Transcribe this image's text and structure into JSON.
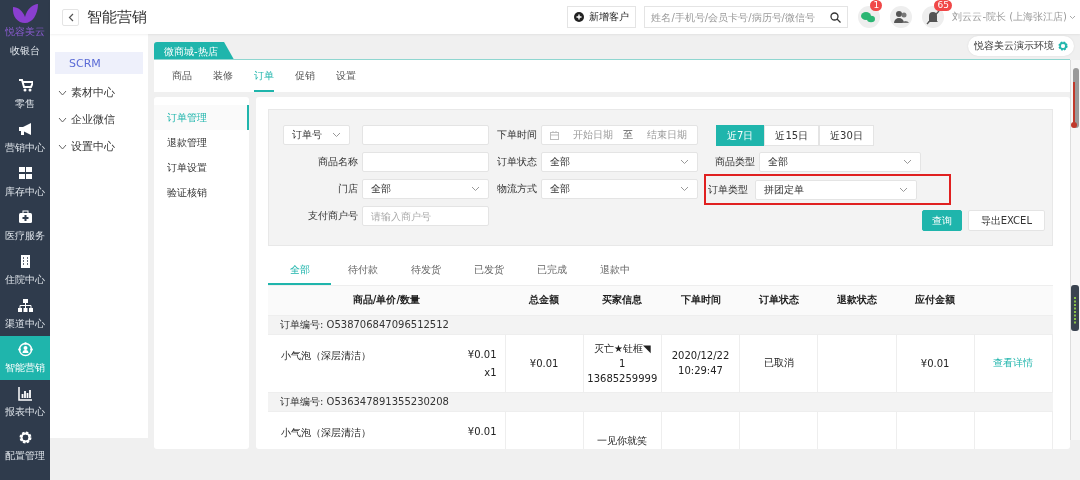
{
  "logo": {
    "text": "悦容美云"
  },
  "nav": [
    {
      "label": "收银台",
      "kind": "none",
      "selected": false
    },
    {
      "label": "零售",
      "kind": "cart",
      "selected": false
    },
    {
      "label": "营销中心",
      "kind": "megaphone",
      "selected": false
    },
    {
      "label": "库存中心",
      "kind": "grid",
      "selected": false
    },
    {
      "label": "医疗服务",
      "kind": "medkit",
      "selected": false
    },
    {
      "label": "住院中心",
      "kind": "building",
      "selected": false
    },
    {
      "label": "渠道中心",
      "kind": "hierarchy",
      "selected": false
    },
    {
      "label": "智能营销",
      "kind": "target",
      "selected": true
    },
    {
      "label": "报表中心",
      "kind": "chart",
      "selected": false
    },
    {
      "label": "配置管理",
      "kind": "gear",
      "selected": false
    }
  ],
  "header": {
    "title": "智能营销",
    "add_button": "新增客户",
    "search": {
      "placeholder": "姓名/手机号/会员卡号/病历号/微信号"
    },
    "icons": [
      {
        "kind": "chat",
        "badge": "1"
      },
      {
        "kind": "group"
      },
      {
        "kind": "bell",
        "badge": "65"
      }
    ],
    "user": "刘云云-院长 (上海张江店)"
  },
  "sub_nav": [
    {
      "label": "SCRM",
      "kind": "link",
      "selected": true
    },
    {
      "label": "素材中心",
      "kind": "group",
      "selected": false
    },
    {
      "label": "企业微信",
      "kind": "group",
      "selected": false
    },
    {
      "label": "设置中心",
      "kind": "group",
      "selected": false
    }
  ],
  "store_tab": "微商城-热店",
  "environment": "悦容美云演示环境",
  "tabs": [
    {
      "label": "商品",
      "selected": false
    },
    {
      "label": "装修",
      "selected": false
    },
    {
      "label": "订单",
      "selected": true
    },
    {
      "label": "促销",
      "selected": false
    },
    {
      "label": "设置",
      "selected": false
    }
  ],
  "side_menu": [
    {
      "label": "订单管理",
      "selected": true
    },
    {
      "label": "退款管理",
      "selected": false
    },
    {
      "label": "订单设置",
      "selected": false
    },
    {
      "label": "验证核销",
      "selected": false
    }
  ],
  "filters": [
    [
      {
        "kind": "select",
        "value": "订单号"
      },
      {
        "kind": "input"
      },
      {
        "kind": "label",
        "text": "下单时间"
      },
      {
        "kind": "daterange",
        "start": "开始日期",
        "separator": "至",
        "end": "结束日期"
      },
      {
        "kind": "segmented",
        "options": [
          {
            "label": "近7日",
            "selected": true
          },
          {
            "label": "近15日",
            "selected": false
          },
          {
            "label": "近30日",
            "selected": false
          }
        ]
      }
    ],
    [
      {
        "kind": "label",
        "text": "商品名称"
      },
      {
        "kind": "input"
      },
      {
        "kind": "label",
        "text": "订单状态"
      },
      {
        "kind": "select",
        "value": "全部"
      },
      {
        "kind": "label",
        "text": "商品类型"
      },
      {
        "kind": "select",
        "value": "全部"
      }
    ],
    [
      {
        "kind": "label",
        "text": "门店"
      },
      {
        "kind": "select",
        "value": "全部"
      },
      {
        "kind": "label",
        "text": "物流方式"
      },
      {
        "kind": "select",
        "value": "全部"
      },
      {
        "kind": "group",
        "highlighted": true,
        "label": "订单类型",
        "value": "拼团定单"
      }
    ],
    [
      {
        "kind": "label",
        "text": "支付商户号"
      },
      {
        "kind": "input",
        "placeholder": "请输入商户号"
      },
      {
        "kind": "actions",
        "buttons": [
          {
            "label": "查询",
            "primary": true
          },
          {
            "label": "导出EXCEL",
            "primary": false
          }
        ]
      }
    ]
  ],
  "status_tabs": [
    {
      "label": "全部",
      "selected": true
    },
    {
      "label": "待付款",
      "selected": false
    },
    {
      "label": "待发货",
      "selected": false
    },
    {
      "label": "已发货",
      "selected": false
    },
    {
      "label": "已完成",
      "selected": false
    },
    {
      "label": "退款中",
      "selected": false
    }
  ],
  "table": {
    "columns": [
      "商品/单价/数量",
      "总金额",
      "买家信息",
      "下单时间",
      "订单状态",
      "退款状态",
      "应付金额"
    ],
    "orders": [
      {
        "order_no": "订单编号: O538706847096512512",
        "product": "小气泡（深层清洁）",
        "price": "¥0.01",
        "qty": "x1",
        "total": "¥0.01",
        "buyer": [
          "灭亡★钍框◥",
          "1",
          "13685259999"
        ],
        "time": [
          "2020/12/22",
          "10:29:47"
        ],
        "status": "已取消",
        "payable": "¥0.01",
        "action": "查看详情"
      },
      {
        "order_no": "订单编号: O536347891355230208",
        "product": "小气泡（深层清洁）",
        "price": "¥0.01",
        "buyer": [
          "一见你就笑"
        ]
      }
    ]
  }
}
